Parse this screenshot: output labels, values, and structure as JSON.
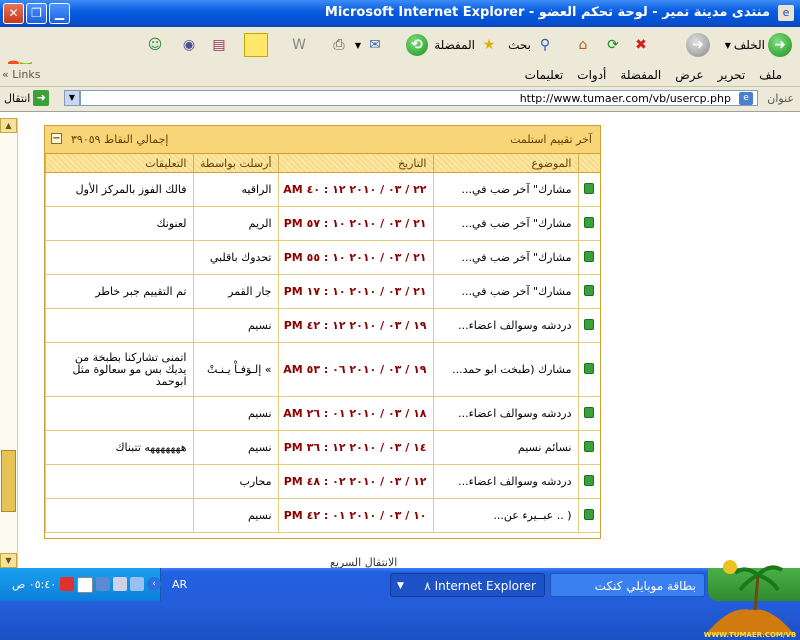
{
  "window": {
    "title": "منتدى مدينة تمير - لوحة تحكم العضو - Microsoft Internet Explorer"
  },
  "toolbar": {
    "back_label": "الخلف",
    "search_label": "بحث",
    "favorites_label": "المفضلة"
  },
  "menu": [
    "ملف",
    "تحرير",
    "عرض",
    "المفضلة",
    "أدوات",
    "تعليمات"
  ],
  "links_label": "Links",
  "address": {
    "label": "عنوان",
    "url": "http://www.tumaer.com/vb/usercp.php",
    "go_label": "انتقال"
  },
  "panel": {
    "title": "آخر تقييم استلمت",
    "points_label": "إجمالي النقاط ٣٩٠٥٩",
    "columns": [
      "الموضوع",
      "التاريخ",
      "أرسلت بواسطة",
      "التعليقات"
    ],
    "rows": [
      {
        "topic": "مشارك\" آخر ضب في...",
        "date": "٢٢ / ٠٣ / ٢٠١٠",
        "time": "١٢ : ٤٠ AM",
        "sender": "الراقيه",
        "comment": "فالك الفوز بالمركز الأول"
      },
      {
        "topic": "مشارك\" آخر ضب في...",
        "date": "٢١ / ٠٣ / ٢٠١٠",
        "time": "١٠ : ٥٧ PM",
        "sender": "الريم",
        "comment": "لعنونك"
      },
      {
        "topic": "مشارك\" آخر ضب في...",
        "date": "٢١ / ٠٣ / ٢٠١٠",
        "time": "١٠ : ٥٥ PM",
        "sender": "تحدوك باقلبي",
        "comment": ""
      },
      {
        "topic": "مشارك\" آخر ضب في...",
        "date": "٢١ / ٠٣ / ٢٠١٠",
        "time": "١٠ : ١٧ PM",
        "sender": "جار القمر",
        "comment": "تم التقييم جبر خاطر"
      },
      {
        "topic": "دردشه وسوالف اعضاء...",
        "date": "١٩ / ٠٣ / ٢٠١٠",
        "time": "١٢ : ٤٢ PM",
        "sender": "نسيم",
        "comment": ""
      },
      {
        "topic": "مشارك (طبخت ابو حمد...",
        "date": "١٩ / ٠٣ / ٢٠١٠",
        "time": "٠٦ : ٥٣ AM",
        "sender": "» إلـوَفـاْ يـنـتْ",
        "comment": "اتمنى تشاركنا بطبخة من يديك بس مو سعالوة مثل ابوحمد"
      },
      {
        "topic": "دردشه وسوالف اعضاء...",
        "date": "١٨ / ٠٣ / ٢٠١٠",
        "time": "٠١ : ٢٦ AM",
        "sender": "نسيم",
        "comment": ""
      },
      {
        "topic": "نسائم نسيم",
        "date": "١٤ / ٠٣ / ٢٠١٠",
        "time": "١٢ : ٣٦ PM",
        "sender": "نسيم",
        "comment": "هههههههه تتبناك"
      },
      {
        "topic": "دردشه وسوالف اعضاء...",
        "date": "١٢ / ٠٣ / ٢٠١٠",
        "time": "٠٢ : ٤٨ PM",
        "sender": "محارب",
        "comment": ""
      },
      {
        "topic": "( .. عبــيرء عن...",
        "date": "١٠ / ٠٣ / ٢٠١٠",
        "time": "٠١ : ٤٢ PM",
        "sender": "نسيم",
        "comment": ""
      }
    ]
  },
  "quick_nav": "الانتقال السريع",
  "taskbar": {
    "clock": "٠٥:٤٠ ص",
    "lang": "AR",
    "task_ie": "Internet Explorer",
    "task_ie_count": "٨",
    "task_other": "بطاقة موبايلي كنكت"
  },
  "watermark_text": "WWW.TUMAER.COM/VB"
}
